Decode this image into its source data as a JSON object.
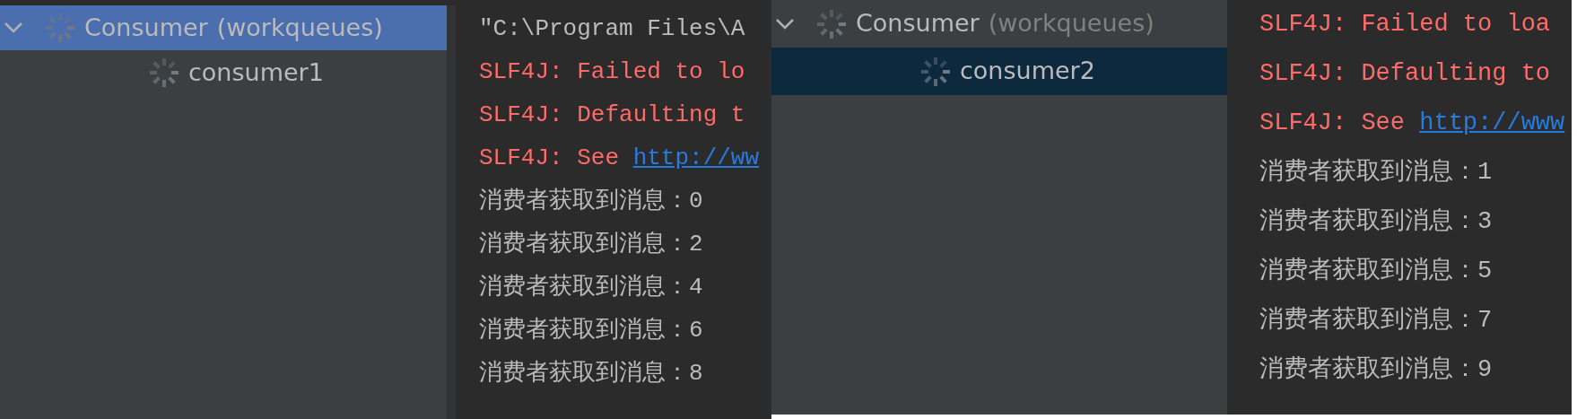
{
  "panels": [
    {
      "tree": [
        {
          "label": "Consumer",
          "detail": "(workqueues)",
          "selected": true,
          "expanded": true,
          "children": [
            {
              "label": "consumer1",
              "selected": false
            }
          ]
        }
      ],
      "console": [
        {
          "kind": "command",
          "text": "\"C:\\Program Files\\A"
        },
        {
          "kind": "error",
          "text": "SLF4J: Failed to lo"
        },
        {
          "kind": "error",
          "text": "SLF4J: Defaulting t"
        },
        {
          "kind": "error",
          "text": "SLF4J: See ",
          "link": "http://ww"
        },
        {
          "kind": "output",
          "text": "消费者获取到消息：0"
        },
        {
          "kind": "output",
          "text": "消费者获取到消息：2"
        },
        {
          "kind": "output",
          "text": "消费者获取到消息：4"
        },
        {
          "kind": "output",
          "text": "消费者获取到消息：6"
        },
        {
          "kind": "output",
          "text": "消费者获取到消息：8"
        }
      ]
    },
    {
      "tree": [
        {
          "label": "Consumer",
          "detail": "(workqueues)",
          "selected": false,
          "expanded": true,
          "children": [
            {
              "label": "consumer2",
              "selected": true
            }
          ]
        }
      ],
      "console": [
        {
          "kind": "error",
          "text": "SLF4J: Failed to loa"
        },
        {
          "kind": "error",
          "text": "SLF4J: Defaulting to"
        },
        {
          "kind": "error",
          "text": "SLF4J: See ",
          "link": "http://www"
        },
        {
          "kind": "output",
          "text": "消费者获取到消息：1"
        },
        {
          "kind": "output",
          "text": "消费者获取到消息：3"
        },
        {
          "kind": "output",
          "text": "消费者获取到消息：5"
        },
        {
          "kind": "output",
          "text": "消费者获取到消息：7"
        },
        {
          "kind": "output",
          "text": "消费者获取到消息：9"
        }
      ]
    }
  ]
}
